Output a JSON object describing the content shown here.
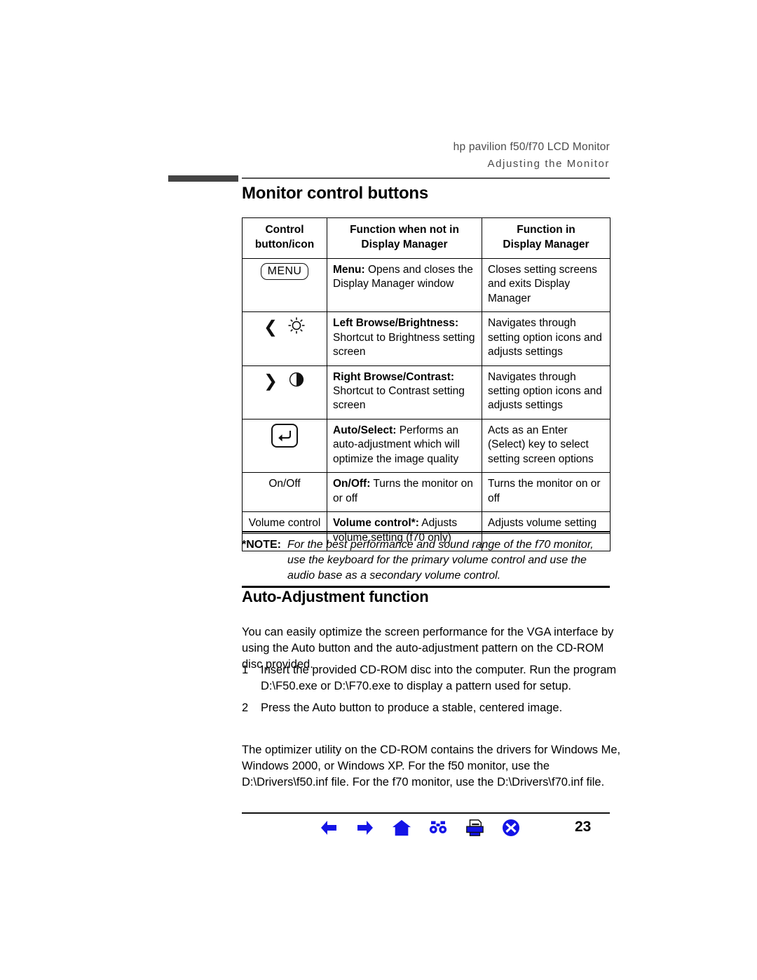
{
  "header": {
    "line1": "hp pavilion f50/f70 LCD Monitor",
    "line2": "Adjusting the Monitor"
  },
  "sections": {
    "title1": "Monitor control buttons",
    "title2": "Auto-Adjustment function"
  },
  "table": {
    "headers": {
      "col1": "Control\nbutton/icon",
      "col1_line1": "Control",
      "col1_line2": "button/icon",
      "col2_line1": "Function when not in",
      "col2_line2": "Display Manager",
      "col3_line1": "Function in",
      "col3_line2": "Display Manager"
    },
    "rows": [
      {
        "icon_label": "MENU",
        "icon_type": "menu-key",
        "fn_bold": "Menu:",
        "fn_text": " Opens and closes the Display Manager window",
        "dm_text": "Closes setting screens and exits Display Manager"
      },
      {
        "icon_label": "< ☼",
        "icon_type": "left-brightness",
        "fn_bold": "Left Browse/Brightness:",
        "fn_text": " Shortcut to Brightness setting screen",
        "dm_text": "Navigates through setting option icons and adjusts settings"
      },
      {
        "icon_label": "> ◐",
        "icon_type": "right-contrast",
        "fn_bold": "Right Browse/Contrast:",
        "fn_text": " Shortcut to Contrast setting screen",
        "dm_text": "Navigates through setting option icons and adjusts settings"
      },
      {
        "icon_label": "↵",
        "icon_type": "enter-key",
        "fn_bold": "Auto/Select:",
        "fn_text": " Performs an auto-adjustment which will optimize the image quality",
        "dm_text": "Acts as an Enter (Select) key to select setting screen options"
      },
      {
        "icon_label": "On/Off",
        "icon_type": "text",
        "fn_bold": "On/Off:",
        "fn_text": " Turns the monitor on or off",
        "dm_text": "Turns the monitor on or off"
      },
      {
        "icon_label": "Volume control",
        "icon_type": "text",
        "fn_bold": "Volume control*:",
        "fn_text": " Adjusts volume setting (f70 only)",
        "dm_text": "Adjusts volume setting"
      }
    ]
  },
  "note": {
    "label": "*NOTE:",
    "text": "For the best performance and sound range of the f70 monitor, use the keyboard for the primary volume control and use the audio base as a secondary volume control."
  },
  "body": {
    "intro": "You can easily optimize the screen performance for the VGA interface by using the Auto button and the auto-adjustment pattern on the CD-ROM disc provided.",
    "steps": [
      {
        "num": "1",
        "text": "Insert the provided CD-ROM disc into the computer. Run the program D:\\F50.exe or D:\\F70.exe to display a pattern used for setup."
      },
      {
        "num": "2",
        "text": "Press the Auto button to produce a stable, centered image."
      }
    ],
    "tail": "The optimizer utility on the CD-ROM contains the drivers for Windows Me, Windows 2000, or Windows XP. For the f50 monitor, use the D:\\Drivers\\f50.inf file. For the f70 monitor, use the D:\\Drivers\\f70.inf file."
  },
  "footer": {
    "page_number": "23",
    "icons": [
      "back-arrow-icon",
      "forward-arrow-icon",
      "home-icon",
      "binoculars-icon",
      "printer-icon",
      "close-x-icon"
    ],
    "accent_color": "#1414E6"
  }
}
